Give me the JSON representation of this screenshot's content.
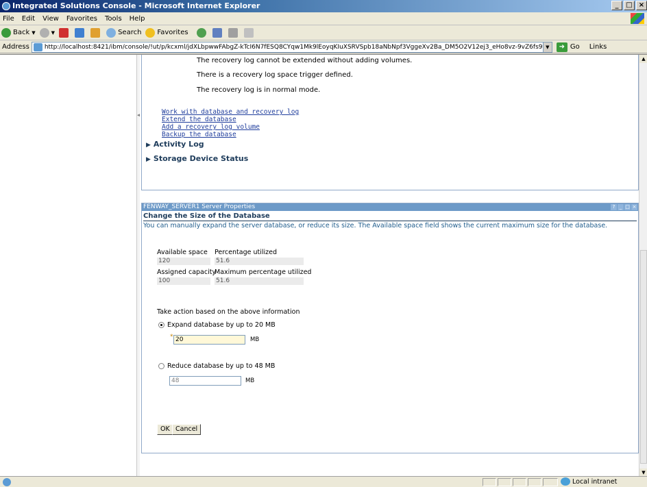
{
  "window": {
    "title": "Integrated Solutions Console - Microsoft Internet Explorer",
    "min_icon": "minimize-icon",
    "max_icon": "maximize-icon",
    "close_icon": "close-icon"
  },
  "menubar": {
    "items": [
      "File",
      "Edit",
      "View",
      "Favorites",
      "Tools",
      "Help"
    ]
  },
  "toolbar": {
    "back_label": "Back",
    "search_label": "Search",
    "favorites_label": "Favorites"
  },
  "address": {
    "label": "Address",
    "url": "http://localhost:8421/ibm/console/!ut/p/kcxml/jdXLbpwwFAbgZ-kTcI6N7fESQ8CYqw1Mk9lEoyqKIuXSRVSpb18aNbNpf3VggeXv2Ba_DM5O2V12ej3_eHo8vz-9vZ6fs9vspN_p48p",
    "go_label": "Go",
    "links_label": "Links"
  },
  "recovery_log": {
    "lines": [
      "The recovery log cannot be extended without adding volumes.",
      "There is a recovery log space trigger defined.",
      "The recovery log is in normal mode."
    ],
    "links": [
      "Work with database and recovery log",
      "Extend the database",
      "Add a recovery log volume",
      "Backup the database"
    ]
  },
  "sections": {
    "activity_log": "Activity Log",
    "storage_device_status": "Storage Device Status"
  },
  "props": {
    "title": "FENWAY_SERVER1 Server Properties",
    "heading": "Change the Size of the Database",
    "description": "You can manually expand the server database, or reduce its size. The Available space field shows the current maximum size for the database.",
    "fields": {
      "available_space_label": "Available space",
      "available_space_value": "120",
      "percentage_utilized_label": "Percentage utilized",
      "percentage_utilized_value": "51.6",
      "assigned_capacity_label": "Assigned capacity",
      "assigned_capacity_value": "100",
      "max_percentage_label": "Maximum percentage utilized",
      "max_percentage_value": "51.6"
    },
    "action_label": "Take action based on the above information",
    "expand_label": "Expand database by up to 20 MB",
    "expand_value": "20",
    "expand_unit": "MB",
    "reduce_label": "Reduce database by up to 48 MB",
    "reduce_placeholder": "48",
    "reduce_unit": "MB",
    "ok_label": "OK",
    "cancel_label": "Cancel"
  },
  "status": {
    "zone": "Local intranet"
  }
}
